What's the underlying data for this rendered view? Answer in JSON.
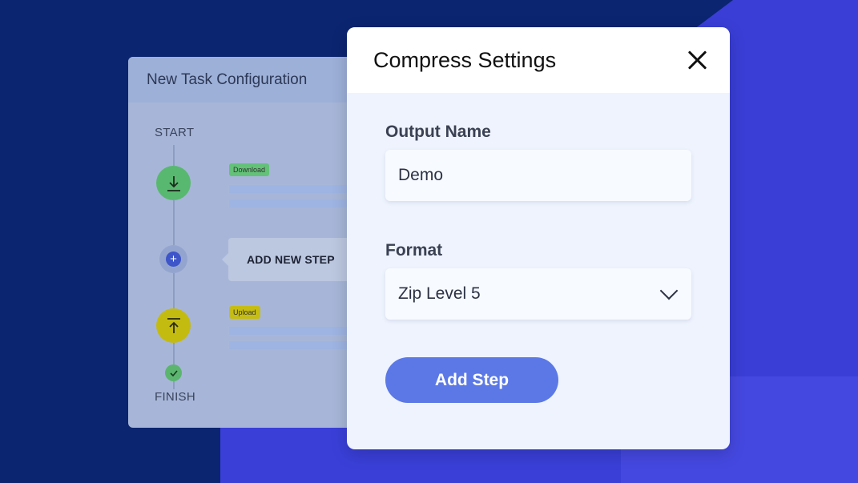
{
  "colors": {
    "background": "#0b2570",
    "accent": "#5b78e6",
    "download_node": "#58b86f",
    "upload_node": "#c4bb10"
  },
  "config_panel": {
    "title": "New Task Configuration",
    "start_label": "START",
    "finish_label": "FINISH",
    "steps": [
      {
        "tag": "Download",
        "icon": "download-icon"
      },
      {
        "tag": "Upload",
        "icon": "upload-icon"
      }
    ],
    "add_step_label": "ADD NEW STEP"
  },
  "modal": {
    "title": "Compress Settings",
    "output_name_label": "Output Name",
    "output_name_value": "Demo",
    "format_label": "Format",
    "format_value": "Zip Level 5",
    "submit_label": "Add Step"
  }
}
